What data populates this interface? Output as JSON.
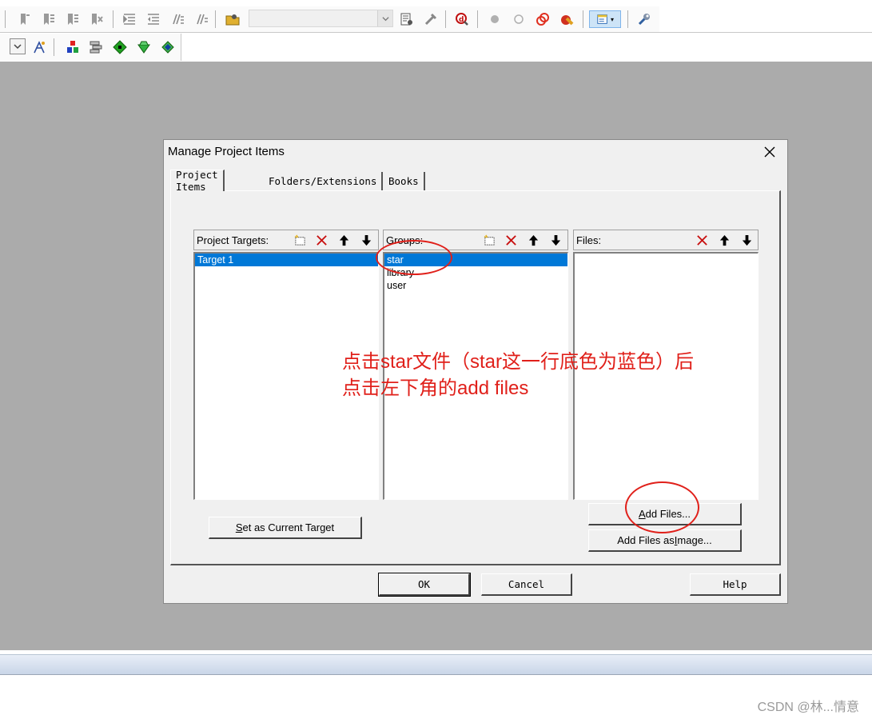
{
  "toolbar_top": {
    "icons": [
      "bookmark-icon",
      "prev-bookmark-icon",
      "next-bookmark-icon",
      "clear-bookmarks-icon",
      "indent-icon",
      "unindent-icon",
      "comment-icon",
      "uncomment-icon",
      "find-in-files-icon"
    ],
    "icons_right": [
      "incremental-find-icon",
      "debug-icon",
      "breakpoint-icon",
      "disable-breakpoint-icon",
      "kill-breakpoints-icon",
      "kill-all-icon",
      "configure-window-icon",
      "settings-wrench-icon"
    ]
  },
  "toolbar_second": {
    "icons": [
      "target-options-icon",
      "pack-installer-icon",
      "manage-run-time-icon",
      "select-device-icon",
      "event-recorder-icon"
    ]
  },
  "dialog": {
    "title": "Manage Project Items",
    "tabs": [
      "Project Items",
      "Folders/Extensions",
      "Books"
    ],
    "targets": {
      "title": "Project Targets:",
      "items": [
        "Target 1"
      ],
      "selected": 0
    },
    "groups": {
      "title": "Groups:",
      "items": [
        "star",
        "library",
        "user"
      ],
      "selected": 0
    },
    "files": {
      "title": "Files:",
      "items": []
    },
    "buttons": {
      "set_current_prefix": "S",
      "set_current_rest": "et as Current Target",
      "add_files_prefix": "A",
      "add_files_rest": "dd Files...",
      "add_image_start": "Add Files as ",
      "add_image_accel": "I",
      "add_image_end": "mage...",
      "ok": "OK",
      "cancel": "Cancel",
      "help": "Help"
    }
  },
  "annotation": {
    "line1": "点击star文件（star这一行底色为蓝色）后",
    "line2": "点击左下角的add files",
    "color": "#e0201a"
  },
  "watermark": "CSDN @林...情意",
  "colors": {
    "workspace": "#ababab",
    "selection": "#0078d7"
  }
}
